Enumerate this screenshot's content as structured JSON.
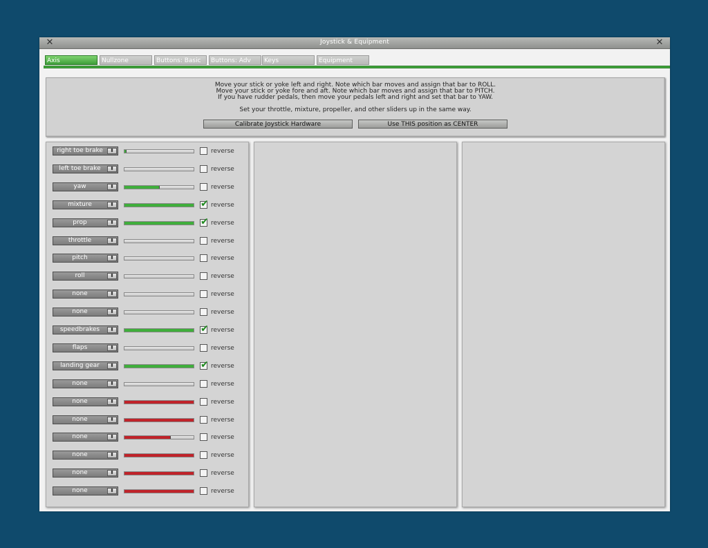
{
  "window": {
    "title": "Joystick & Equipment",
    "close_glyph": "✕"
  },
  "tabs": [
    {
      "label": "Axis",
      "active": true
    },
    {
      "label": "Nullzone",
      "active": false
    },
    {
      "label": "Buttons: Basic",
      "active": false
    },
    {
      "label": "Buttons: Adv",
      "active": false
    },
    {
      "label": "Keys",
      "active": false
    },
    {
      "label": "Equipment",
      "active": false
    }
  ],
  "instructions": {
    "line1": "Move your stick or yoke left and right. Note which bar moves and assign that bar to ROLL.",
    "line2": "Move your stick or yoke fore and aft. Note which bar moves and assign that bar to PITCH.",
    "line3": "If you have rudder pedals, then move your pedals left and right and set that bar to YAW.",
    "line4": "Set your throttle, mixture, propeller, and other sliders up in the same way."
  },
  "buttons": {
    "calibrate": "Calibrate Joystick Hardware",
    "center": "Use THIS position as CENTER"
  },
  "colors": {
    "green": "#3fae3b",
    "red": "#c0232a"
  },
  "reverse_label": "reverse",
  "axes": [
    {
      "assignment": "right toe brake",
      "level": 0.02,
      "color": "green",
      "reversed": false
    },
    {
      "assignment": "left toe brake",
      "level": 0.0,
      "color": "green",
      "reversed": false
    },
    {
      "assignment": "yaw",
      "level": 0.5,
      "color": "green",
      "reversed": false
    },
    {
      "assignment": "mixture",
      "level": 1.0,
      "color": "green",
      "reversed": true
    },
    {
      "assignment": "prop",
      "level": 1.0,
      "color": "green",
      "reversed": true
    },
    {
      "assignment": "throttle",
      "level": 0.0,
      "color": "green",
      "reversed": false
    },
    {
      "assignment": "pitch",
      "level": 0.0,
      "color": "green",
      "reversed": false
    },
    {
      "assignment": "roll",
      "level": 0.0,
      "color": "green",
      "reversed": false
    },
    {
      "assignment": "none",
      "level": 0.0,
      "color": "green",
      "reversed": false
    },
    {
      "assignment": "none",
      "level": 0.0,
      "color": "green",
      "reversed": false
    },
    {
      "assignment": "speedbrakes",
      "level": 1.0,
      "color": "green",
      "reversed": true
    },
    {
      "assignment": "flaps",
      "level": 0.0,
      "color": "green",
      "reversed": false
    },
    {
      "assignment": "landing gear",
      "level": 1.0,
      "color": "green",
      "reversed": true
    },
    {
      "assignment": "none",
      "level": 0.0,
      "color": "green",
      "reversed": false
    },
    {
      "assignment": "none",
      "level": 1.0,
      "color": "red",
      "reversed": false
    },
    {
      "assignment": "none",
      "level": 1.0,
      "color": "red",
      "reversed": false
    },
    {
      "assignment": "none",
      "level": 0.66,
      "color": "red",
      "reversed": false
    },
    {
      "assignment": "none",
      "level": 1.0,
      "color": "red",
      "reversed": false
    },
    {
      "assignment": "none",
      "level": 1.0,
      "color": "red",
      "reversed": false
    },
    {
      "assignment": "none",
      "level": 1.0,
      "color": "red",
      "reversed": false
    }
  ]
}
